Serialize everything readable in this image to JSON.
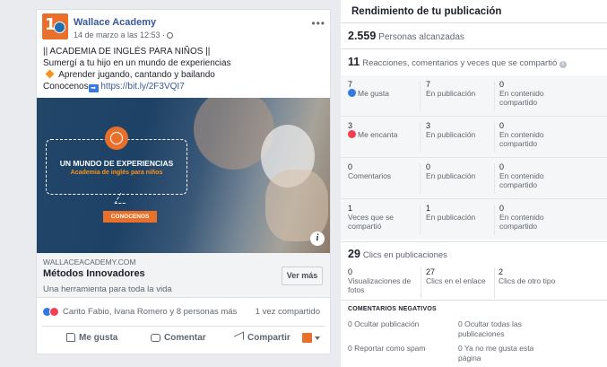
{
  "post": {
    "page_name": "Wallace Academy",
    "avatar_text": "1",
    "meta": "14 de marzo a las 12:53 ·",
    "more": "•••",
    "text_lines": [
      "|| ACADEMIA DE INGLÉS PARA NIÑOS ||",
      "Sumergí a tu hijo en un mundo de experiencias",
      "Aprender jugando, cantando y bailando",
      "Conocenos"
    ],
    "link_text": "https://bit.ly/2F3VQI7",
    "image": {
      "title": "UN MUNDO DE EXPERIENCIAS",
      "subtitle": "Academia de inglés para niños",
      "button": "CONOCENOS",
      "info": "i"
    },
    "link_preview": {
      "domain": "WALLACEACADEMY.COM",
      "title": "Métodos Innovadores",
      "description": "Una herramienta para toda la vida",
      "button": "Ver más"
    },
    "reactions_text": "Carito Fabio, Ivana Romero y 8 personas más",
    "shares_text": "1 vez compartido",
    "actions": {
      "like": "Me gusta",
      "comment": "Comentar",
      "share": "Compartir"
    }
  },
  "insights": {
    "title": "Rendimiento de tu publicación",
    "reach_value": "2.559",
    "reach_label": "Personas alcanzadas",
    "reactions_value": "11",
    "reactions_label": "Reacciones, comentarios y veces que se compartió",
    "help": "i",
    "rows": [
      {
        "label": "Me gusta",
        "icon": "like-icon",
        "total": "7",
        "on_post": "7",
        "on_post_label": "En publicación",
        "shared": "0",
        "shared_label": "En contenido compartido"
      },
      {
        "label": "Me encanta",
        "icon": "love-icon",
        "total": "3",
        "on_post": "3",
        "on_post_label": "En publicación",
        "shared": "0",
        "shared_label": "En contenido compartido"
      },
      {
        "label": "Comentarios",
        "icon": "",
        "total": "0",
        "on_post": "0",
        "on_post_label": "En publicación",
        "shared": "0",
        "shared_label": "En contenido compartido"
      },
      {
        "label": "Veces que se compartió",
        "icon": "",
        "total": "1",
        "on_post": "1",
        "on_post_label": "En publicación",
        "shared": "0",
        "shared_label": "En contenido compartido"
      }
    ],
    "clicks_value": "29",
    "clicks_label": "Clics en publicaciones",
    "clicks": [
      {
        "value": "0",
        "label": "Visualizaciones de fotos"
      },
      {
        "value": "27",
        "label": "Clics en el enlace"
      },
      {
        "value": "2",
        "label": "Clics de otro tipo"
      }
    ],
    "negative_title": "COMENTARIOS NEGATIVOS",
    "negative": [
      {
        "value": "0",
        "label": "Ocultar publicación"
      },
      {
        "value": "0",
        "label": "Ocultar todas las publicaciones"
      },
      {
        "value": "0",
        "label": "Reportar como spam"
      },
      {
        "value": "0",
        "label": "Ya no me gusta esta página"
      }
    ]
  },
  "colors": {
    "brand_orange": "#e8702a",
    "facebook_link": "#385898",
    "like_blue": "#3578e5",
    "love_red": "#f33e58"
  }
}
